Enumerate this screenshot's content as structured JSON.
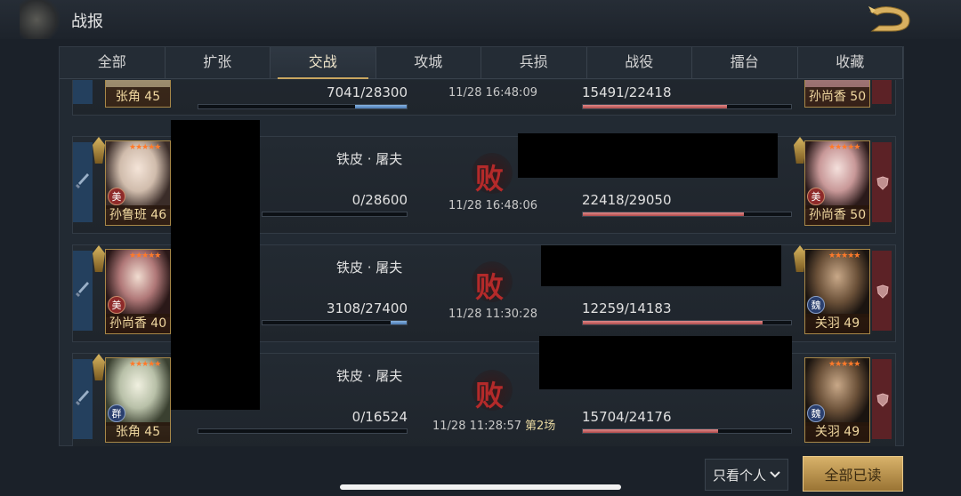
{
  "header": {
    "title": "战报"
  },
  "tabs": [
    {
      "label": "全部"
    },
    {
      "label": "扩张"
    },
    {
      "label": "交战"
    },
    {
      "label": "攻城"
    },
    {
      "label": "兵损"
    },
    {
      "label": "战役"
    },
    {
      "label": "擂台"
    },
    {
      "label": "收藏"
    }
  ],
  "active_tab": "交战",
  "records": [
    {
      "attacker_hero": "张角 45",
      "attacker_name": "",
      "attacker_hp": "7041/28300",
      "attacker_hp_fraction": 0.249,
      "result": "",
      "time": "11/28 16:48:09",
      "round": "",
      "defender_hp": "15491/22418",
      "defender_hp_fraction": 0.691,
      "defender_hero": "孙尚香 50"
    },
    {
      "attacker_hero": "孙鲁班 46",
      "attacker_badge": "美",
      "attacker_stars": "★★★★★",
      "attacker_name": "铁皮 · 屠夫",
      "attacker_hp": "0/28600",
      "attacker_hp_fraction": 0,
      "result": "败",
      "time": "11/28 16:48:06",
      "round": "",
      "defender_hp": "22418/29050",
      "defender_hp_fraction": 0.772,
      "defender_hero": "孙尚香 50",
      "defender_badge": "美",
      "defender_stars": "★★★★★"
    },
    {
      "attacker_hero": "孙尚香 40",
      "attacker_badge": "美",
      "attacker_stars": "★★★★★",
      "attacker_name": "铁皮 · 屠夫",
      "attacker_hp": "3108/27400",
      "attacker_hp_fraction": 0.113,
      "result": "败",
      "time": "11/28 11:30:28",
      "round": "",
      "defender_hp": "12259/14183",
      "defender_hp_fraction": 0.864,
      "defender_hero": "关羽 49",
      "defender_badge": "魏",
      "defender_stars": "★★★★★"
    },
    {
      "attacker_hero": "张角 45",
      "attacker_badge": "群",
      "attacker_stars": "★★★★★",
      "attacker_name": "铁皮 · 屠夫",
      "attacker_hp": "0/16524",
      "attacker_hp_fraction": 0,
      "result": "败",
      "time": "11/28 11:28:57",
      "round": "第2场",
      "defender_hp": "15704/24176",
      "defender_hp_fraction": 0.65,
      "defender_hero": "关羽 49",
      "defender_badge": "魏",
      "defender_stars": "★★★★★"
    }
  ],
  "footer": {
    "filter_label": "只看个人",
    "read_all_label": "全部已读"
  },
  "colors": {
    "active_tab_accent": "#c8a660",
    "defeat_red": "#b42a2a",
    "attacker_bar": "#6e9ed4",
    "defender_bar": "#c86464"
  }
}
